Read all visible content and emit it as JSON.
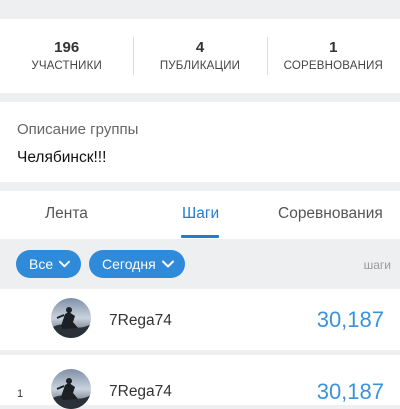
{
  "stats": [
    {
      "value": "196",
      "label": "УЧАСТНИКИ"
    },
    {
      "value": "4",
      "label": "ПУБЛИКАЦИИ"
    },
    {
      "value": "1",
      "label": "СОРЕВНОВАНИЯ"
    }
  ],
  "description": {
    "title": "Описание группы",
    "text": "Челябинск!!!"
  },
  "tabs": [
    {
      "label": "Лента",
      "active": false
    },
    {
      "label": "Шаги",
      "active": true
    },
    {
      "label": "Соревнования",
      "active": false
    }
  ],
  "filters": {
    "scope": "Все",
    "period": "Сегодня",
    "unit": "шаги"
  },
  "leaderboard": [
    {
      "rank": "",
      "name": "7Rega74",
      "steps": "30,187"
    },
    {
      "rank": "1",
      "name": "7Rega74",
      "steps": "30,187"
    }
  ],
  "colors": {
    "accent": "#1f7ed4",
    "chip": "#2f8ad9",
    "steps": "#3a93df",
    "background": "#eeeff1"
  }
}
